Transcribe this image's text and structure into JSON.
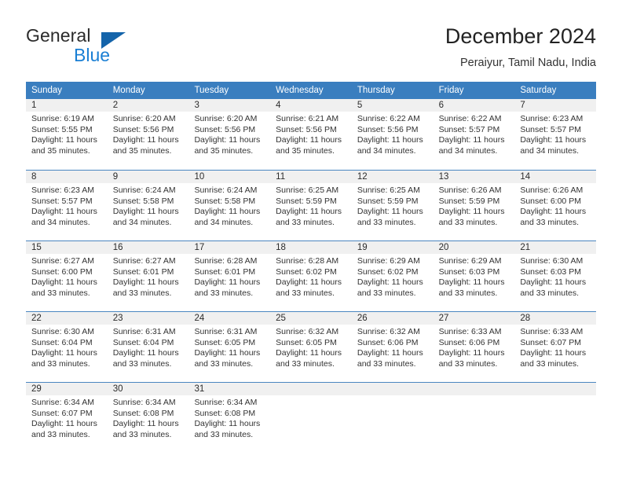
{
  "logo": {
    "word_top": "General",
    "word_bottom": "Blue",
    "triangle_color": "#1464aa",
    "blue_color": "#1a7fd4"
  },
  "header": {
    "month_title": "December 2024",
    "location": "Peraiyur, Tamil Nadu, India"
  },
  "theme": {
    "header_bg": "#3a7ebf",
    "header_text": "#ffffff",
    "daynum_bg": "#f0f0f0",
    "week_divider": "#4a86c0",
    "body_text": "#333333"
  },
  "weekday_headers": [
    "Sunday",
    "Monday",
    "Tuesday",
    "Wednesday",
    "Thursday",
    "Friday",
    "Saturday"
  ],
  "weeks": [
    [
      {
        "day": "1",
        "sunrise": "Sunrise: 6:19 AM",
        "sunset": "Sunset: 5:55 PM",
        "daylight1": "Daylight: 11 hours",
        "daylight2": "and 35 minutes."
      },
      {
        "day": "2",
        "sunrise": "Sunrise: 6:20 AM",
        "sunset": "Sunset: 5:56 PM",
        "daylight1": "Daylight: 11 hours",
        "daylight2": "and 35 minutes."
      },
      {
        "day": "3",
        "sunrise": "Sunrise: 6:20 AM",
        "sunset": "Sunset: 5:56 PM",
        "daylight1": "Daylight: 11 hours",
        "daylight2": "and 35 minutes."
      },
      {
        "day": "4",
        "sunrise": "Sunrise: 6:21 AM",
        "sunset": "Sunset: 5:56 PM",
        "daylight1": "Daylight: 11 hours",
        "daylight2": "and 35 minutes."
      },
      {
        "day": "5",
        "sunrise": "Sunrise: 6:22 AM",
        "sunset": "Sunset: 5:56 PM",
        "daylight1": "Daylight: 11 hours",
        "daylight2": "and 34 minutes."
      },
      {
        "day": "6",
        "sunrise": "Sunrise: 6:22 AM",
        "sunset": "Sunset: 5:57 PM",
        "daylight1": "Daylight: 11 hours",
        "daylight2": "and 34 minutes."
      },
      {
        "day": "7",
        "sunrise": "Sunrise: 6:23 AM",
        "sunset": "Sunset: 5:57 PM",
        "daylight1": "Daylight: 11 hours",
        "daylight2": "and 34 minutes."
      }
    ],
    [
      {
        "day": "8",
        "sunrise": "Sunrise: 6:23 AM",
        "sunset": "Sunset: 5:57 PM",
        "daylight1": "Daylight: 11 hours",
        "daylight2": "and 34 minutes."
      },
      {
        "day": "9",
        "sunrise": "Sunrise: 6:24 AM",
        "sunset": "Sunset: 5:58 PM",
        "daylight1": "Daylight: 11 hours",
        "daylight2": "and 34 minutes."
      },
      {
        "day": "10",
        "sunrise": "Sunrise: 6:24 AM",
        "sunset": "Sunset: 5:58 PM",
        "daylight1": "Daylight: 11 hours",
        "daylight2": "and 34 minutes."
      },
      {
        "day": "11",
        "sunrise": "Sunrise: 6:25 AM",
        "sunset": "Sunset: 5:59 PM",
        "daylight1": "Daylight: 11 hours",
        "daylight2": "and 33 minutes."
      },
      {
        "day": "12",
        "sunrise": "Sunrise: 6:25 AM",
        "sunset": "Sunset: 5:59 PM",
        "daylight1": "Daylight: 11 hours",
        "daylight2": "and 33 minutes."
      },
      {
        "day": "13",
        "sunrise": "Sunrise: 6:26 AM",
        "sunset": "Sunset: 5:59 PM",
        "daylight1": "Daylight: 11 hours",
        "daylight2": "and 33 minutes."
      },
      {
        "day": "14",
        "sunrise": "Sunrise: 6:26 AM",
        "sunset": "Sunset: 6:00 PM",
        "daylight1": "Daylight: 11 hours",
        "daylight2": "and 33 minutes."
      }
    ],
    [
      {
        "day": "15",
        "sunrise": "Sunrise: 6:27 AM",
        "sunset": "Sunset: 6:00 PM",
        "daylight1": "Daylight: 11 hours",
        "daylight2": "and 33 minutes."
      },
      {
        "day": "16",
        "sunrise": "Sunrise: 6:27 AM",
        "sunset": "Sunset: 6:01 PM",
        "daylight1": "Daylight: 11 hours",
        "daylight2": "and 33 minutes."
      },
      {
        "day": "17",
        "sunrise": "Sunrise: 6:28 AM",
        "sunset": "Sunset: 6:01 PM",
        "daylight1": "Daylight: 11 hours",
        "daylight2": "and 33 minutes."
      },
      {
        "day": "18",
        "sunrise": "Sunrise: 6:28 AM",
        "sunset": "Sunset: 6:02 PM",
        "daylight1": "Daylight: 11 hours",
        "daylight2": "and 33 minutes."
      },
      {
        "day": "19",
        "sunrise": "Sunrise: 6:29 AM",
        "sunset": "Sunset: 6:02 PM",
        "daylight1": "Daylight: 11 hours",
        "daylight2": "and 33 minutes."
      },
      {
        "day": "20",
        "sunrise": "Sunrise: 6:29 AM",
        "sunset": "Sunset: 6:03 PM",
        "daylight1": "Daylight: 11 hours",
        "daylight2": "and 33 minutes."
      },
      {
        "day": "21",
        "sunrise": "Sunrise: 6:30 AM",
        "sunset": "Sunset: 6:03 PM",
        "daylight1": "Daylight: 11 hours",
        "daylight2": "and 33 minutes."
      }
    ],
    [
      {
        "day": "22",
        "sunrise": "Sunrise: 6:30 AM",
        "sunset": "Sunset: 6:04 PM",
        "daylight1": "Daylight: 11 hours",
        "daylight2": "and 33 minutes."
      },
      {
        "day": "23",
        "sunrise": "Sunrise: 6:31 AM",
        "sunset": "Sunset: 6:04 PM",
        "daylight1": "Daylight: 11 hours",
        "daylight2": "and 33 minutes."
      },
      {
        "day": "24",
        "sunrise": "Sunrise: 6:31 AM",
        "sunset": "Sunset: 6:05 PM",
        "daylight1": "Daylight: 11 hours",
        "daylight2": "and 33 minutes."
      },
      {
        "day": "25",
        "sunrise": "Sunrise: 6:32 AM",
        "sunset": "Sunset: 6:05 PM",
        "daylight1": "Daylight: 11 hours",
        "daylight2": "and 33 minutes."
      },
      {
        "day": "26",
        "sunrise": "Sunrise: 6:32 AM",
        "sunset": "Sunset: 6:06 PM",
        "daylight1": "Daylight: 11 hours",
        "daylight2": "and 33 minutes."
      },
      {
        "day": "27",
        "sunrise": "Sunrise: 6:33 AM",
        "sunset": "Sunset: 6:06 PM",
        "daylight1": "Daylight: 11 hours",
        "daylight2": "and 33 minutes."
      },
      {
        "day": "28",
        "sunrise": "Sunrise: 6:33 AM",
        "sunset": "Sunset: 6:07 PM",
        "daylight1": "Daylight: 11 hours",
        "daylight2": "and 33 minutes."
      }
    ],
    [
      {
        "day": "29",
        "sunrise": "Sunrise: 6:34 AM",
        "sunset": "Sunset: 6:07 PM",
        "daylight1": "Daylight: 11 hours",
        "daylight2": "and 33 minutes."
      },
      {
        "day": "30",
        "sunrise": "Sunrise: 6:34 AM",
        "sunset": "Sunset: 6:08 PM",
        "daylight1": "Daylight: 11 hours",
        "daylight2": "and 33 minutes."
      },
      {
        "day": "31",
        "sunrise": "Sunrise: 6:34 AM",
        "sunset": "Sunset: 6:08 PM",
        "daylight1": "Daylight: 11 hours",
        "daylight2": "and 33 minutes."
      },
      {
        "day": "",
        "sunrise": "",
        "sunset": "",
        "daylight1": "",
        "daylight2": ""
      },
      {
        "day": "",
        "sunrise": "",
        "sunset": "",
        "daylight1": "",
        "daylight2": ""
      },
      {
        "day": "",
        "sunrise": "",
        "sunset": "",
        "daylight1": "",
        "daylight2": ""
      },
      {
        "day": "",
        "sunrise": "",
        "sunset": "",
        "daylight1": "",
        "daylight2": ""
      }
    ]
  ]
}
